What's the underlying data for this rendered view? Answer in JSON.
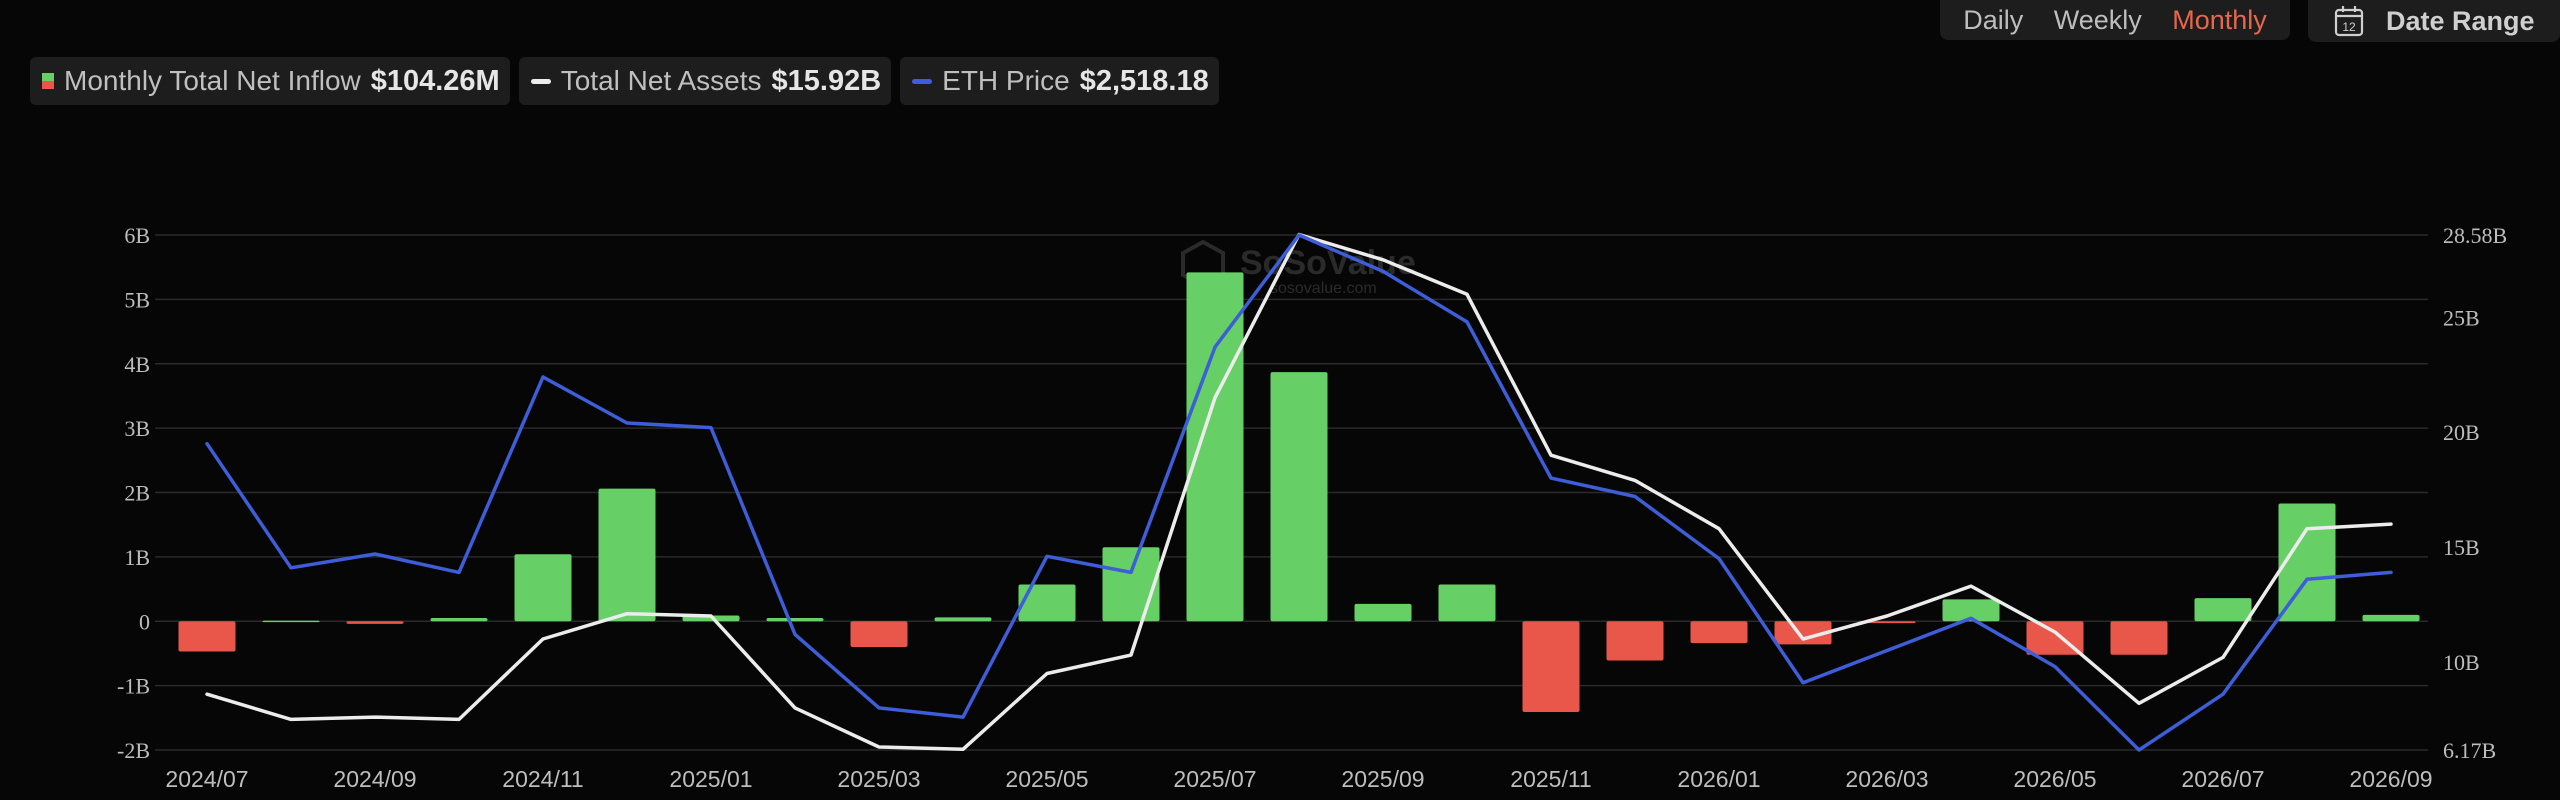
{
  "controls": {
    "interval_options": [
      "Daily",
      "Weekly",
      "Monthly"
    ],
    "interval_selected": "Monthly",
    "date_range_label": "Date Range",
    "calendar_day": "12"
  },
  "legend": {
    "inflow": {
      "name": "Monthly Total Net Inflow",
      "value": "$104.26M"
    },
    "assets": {
      "name": "Total Net Assets",
      "value": "$15.92B"
    },
    "eth": {
      "name": "ETH Price",
      "value": "$2,518.18"
    }
  },
  "watermark": {
    "brand": "SoSoValue",
    "site": "sosovalue.com"
  },
  "colors": {
    "positive": "#66cf66",
    "negative": "#e8574a",
    "assets_line": "#ececec",
    "eth_line": "#3d5ed8",
    "grid": "#2a2a2a",
    "active": "#e8664e"
  },
  "chart_data": {
    "type": "bar",
    "categories": [
      "2024/07",
      "2024/08",
      "2024/09",
      "2024/10",
      "2024/11",
      "2024/12",
      "2025/01",
      "2025/02",
      "2025/03",
      "2025/04",
      "2025/05",
      "2025/06",
      "2025/07",
      "2025/08",
      "2025/09",
      "2025/10",
      "2025/11",
      "2025/12",
      "2026/01",
      "2026/02",
      "2026/03",
      "2026/04",
      "2026/05",
      "2026/06",
      "2026/07",
      "2026/08",
      "2026/09"
    ],
    "x_tick_labels": [
      "2024/07",
      "2024/09",
      "2024/11",
      "2025/01",
      "2025/03",
      "2025/05",
      "2025/07",
      "2025/09",
      "2025/11",
      "2026/01",
      "2026/03",
      "2026/05",
      "2026/07",
      "2026/09"
    ],
    "y_left": {
      "ticks": [
        "-2B",
        "-1B",
        "0",
        "1B",
        "2B",
        "3B",
        "4B",
        "5B",
        "6B"
      ],
      "range": [
        -2,
        6
      ]
    },
    "y_right": {
      "ticks": [
        "6.17B",
        "10B",
        "15B",
        "20B",
        "25B",
        "28.58B"
      ],
      "range": [
        6.17,
        28.58
      ]
    },
    "series": [
      {
        "name": "Monthly Total Net Inflow",
        "axis": "left",
        "unit": "B",
        "values": [
          -0.47,
          0.01,
          -0.04,
          0.05,
          1.04,
          2.06,
          0.09,
          0.05,
          -0.4,
          0.06,
          0.57,
          1.15,
          5.42,
          3.87,
          0.27,
          0.57,
          -1.41,
          -0.61,
          -0.34,
          -0.36,
          -0.03,
          0.34,
          -0.52,
          -0.52,
          0.36,
          1.83,
          0.1
        ]
      },
      {
        "name": "Total Net Assets",
        "axis": "right",
        "unit": "B",
        "values": [
          8.6,
          7.5,
          7.6,
          7.5,
          11.0,
          12.1,
          12.0,
          8.0,
          6.3,
          6.2,
          9.5,
          10.3,
          21.5,
          28.6,
          27.5,
          26.0,
          19.0,
          17.9,
          15.8,
          11.0,
          12.0,
          13.3,
          11.3,
          8.2,
          10.2,
          15.8,
          16.0
        ]
      },
      {
        "name": "ETH Price",
        "axis": "right",
        "unit": "B",
        "values": [
          19.5,
          14.1,
          14.7,
          13.9,
          22.4,
          20.4,
          20.2,
          11.2,
          8.0,
          7.6,
          14.6,
          13.9,
          23.7,
          28.58,
          27.0,
          24.8,
          18.0,
          17.2,
          14.5,
          9.1,
          10.5,
          11.9,
          9.8,
          6.17,
          8.6,
          13.6,
          13.9
        ]
      }
    ]
  }
}
